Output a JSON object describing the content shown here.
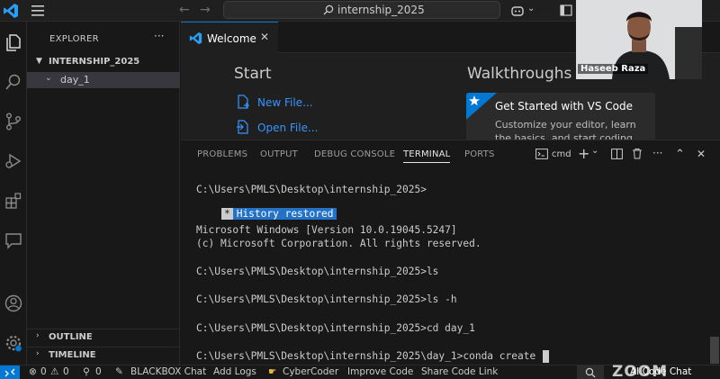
{
  "titlebar": {
    "search_text": "internship_2025"
  },
  "sidebar": {
    "title": "EXPLORER",
    "more": "···",
    "root_folder": "INTERNSHIP_2025",
    "subfolder": "day_1",
    "sections": [
      "OUTLINE",
      "TIMELINE"
    ]
  },
  "editor": {
    "tab_label": "Welcome",
    "start_heading": "Start",
    "start_links": [
      "New File...",
      "Open File..."
    ],
    "walkthroughs_heading": "Walkthroughs",
    "card_title": "Get Started with VS Code",
    "card_desc": "Customize your editor, learn the basics, and start coding"
  },
  "panel": {
    "tabs": [
      "PROBLEMS",
      "OUTPUT",
      "DEBUG CONSOLE",
      "TERMINAL",
      "PORTS"
    ],
    "active_tab": "TERMINAL",
    "shell_label": "cmd",
    "controls": {
      "add": "+",
      "caret": "⌄",
      "more": "···",
      "up": "⌃",
      "close": "✕"
    }
  },
  "terminal": {
    "lines": [
      "C:\\Users\\PMLS\\Desktop\\internship_2025>",
      "Microsoft Windows [Version 10.0.19045.5247]",
      "(c) Microsoft Corporation. All rights reserved.",
      "C:\\Users\\PMLS\\Desktop\\internship_2025>ls",
      "C:\\Users\\PMLS\\Desktop\\internship_2025>ls -h",
      "C:\\Users\\PMLS\\Desktop\\internship_2025>cd day_1",
      "C:\\Users\\PMLS\\Desktop\\internship_2025\\day_1>conda create"
    ],
    "history_star": "*",
    "history_text": "History restored"
  },
  "statusbar": {
    "errors": "0",
    "warnings": "0",
    "ports": "0",
    "items": [
      "BLACKBOX Chat",
      "Add Logs",
      "CyberCoder",
      "Improve Code",
      "Share Code Link"
    ],
    "right_item": "AI Code Chat",
    "zoom": "ZOOM"
  },
  "webcam": {
    "name": "Haseeb Raza"
  },
  "colors": {
    "accent": "#0078d4",
    "link": "#3794ff",
    "highlight": "#2472c8"
  }
}
